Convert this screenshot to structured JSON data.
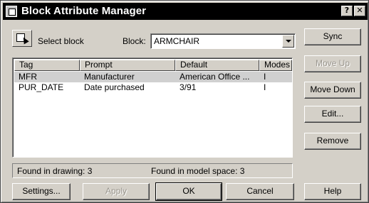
{
  "window": {
    "title": "Block Attribute Manager",
    "help_glyph": "?",
    "close_glyph": "✕"
  },
  "toolbar": {
    "select_block_label": "Select block",
    "block_label": "Block:",
    "block_value": "ARMCHAIR"
  },
  "list": {
    "columns": [
      "Tag",
      "Prompt",
      "Default",
      "Modes"
    ],
    "rows": [
      {
        "tag": "MFR",
        "prompt": "Manufacturer",
        "default": "American Office ...",
        "modes": "I",
        "selected": true
      },
      {
        "tag": "PUR_DATE",
        "prompt": "Date purchased",
        "default": "3/91",
        "modes": "I",
        "selected": false
      }
    ]
  },
  "status": {
    "found_in_drawing": "Found in drawing: 3",
    "found_in_model_space": "Found in model space: 3"
  },
  "side_buttons": {
    "sync": "Sync",
    "move_up": "Move Up",
    "move_down": "Move Down",
    "edit": "Edit...",
    "remove": "Remove"
  },
  "bottom_buttons": {
    "settings": "Settings...",
    "apply": "Apply",
    "ok": "OK",
    "cancel": "Cancel",
    "help": "Help"
  }
}
